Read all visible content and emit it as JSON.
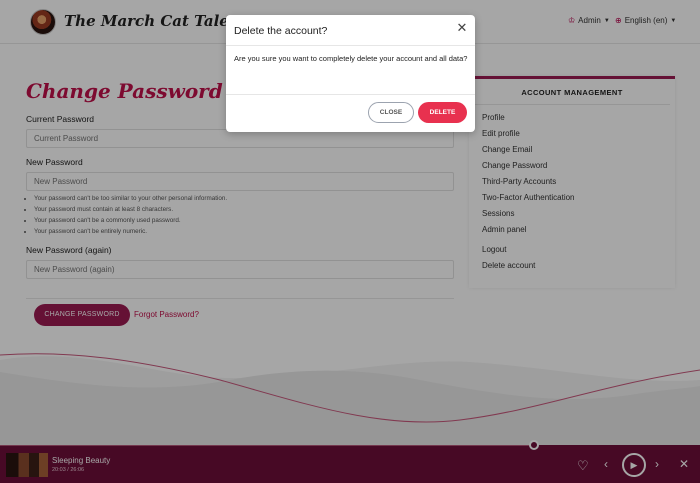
{
  "header": {
    "brand": "The March Cat Tales",
    "user_menu": "Admin",
    "language_menu": "English (en)"
  },
  "main": {
    "title": "Change Password",
    "current_password_label": "Current Password",
    "current_password_placeholder": "Current Password",
    "new_password_label": "New Password",
    "new_password_placeholder": "New Password",
    "help": [
      "Your password can't be too similar to your other personal information.",
      "Your password must contain at least 8 characters.",
      "Your password can't be a commonly used password.",
      "Your password can't be entirely numeric."
    ],
    "new_password_again_label": "New Password (again)",
    "new_password_again_placeholder": "New Password (again)",
    "change_button": "CHANGE PASSWORD",
    "forgot_link": "Forgot Password?"
  },
  "sidebar": {
    "title": "ACCOUNT MANAGEMENT",
    "items": [
      "Profile",
      "Edit profile",
      "Change Email",
      "Change Password",
      "Third-Party Accounts",
      "Two-Factor Authentication",
      "Sessions",
      "Admin panel",
      "Logout",
      "Delete account"
    ]
  },
  "player": {
    "title": "Sleeping Beauty",
    "time": "20:03 / 26:06",
    "progress": 0.763
  },
  "modal": {
    "title": "Delete the account?",
    "body": "Are you sure you want to completely delete your account and all data?",
    "close_label": "CLOSE",
    "delete_label": "DELETE"
  },
  "colors": {
    "accent": "#c0104a",
    "player_bg": "#6e0f3a",
    "delete": "#e8314f"
  }
}
